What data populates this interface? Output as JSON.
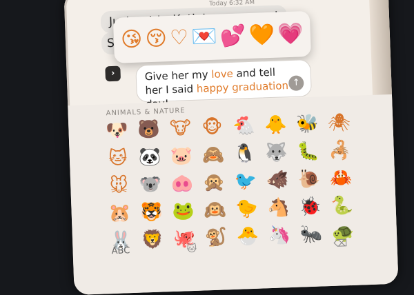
{
  "conversation": {
    "timestamp": "Today 6:32 AM",
    "messages": [
      "Just got to Katie's ceremony!",
      "S"
    ]
  },
  "compose": {
    "parts": [
      {
        "text": "Give her my ",
        "highlight": false
      },
      {
        "text": "love",
        "highlight": true
      },
      {
        "text": " and tell her I said ",
        "highlight": false
      },
      {
        "text": "happy graduation",
        "highlight": true
      },
      {
        "text": " day!",
        "highlight": false
      }
    ],
    "send_icon": "↑",
    "apps_icon": "›"
  },
  "emoji_suggestions": [
    "😘",
    "😚",
    "♡",
    "💌",
    "💕",
    "🧡",
    "💗"
  ],
  "keyboard": {
    "section": "ANIMALS & NATURE",
    "emojis": [
      "🐶",
      "🐻",
      "🐮",
      "🐵",
      "🐔",
      "🐥",
      "🐝",
      "🕷",
      "🐱",
      "🐼",
      "🐷",
      "🙈",
      "🐧",
      "🐺",
      "🐛",
      "🦂",
      "🐭",
      "🐨",
      "🐽",
      "🙊",
      "🐦",
      "🐗",
      "🐌",
      "🦀",
      "🐹",
      "🐯",
      "🐸",
      "🙉",
      "🐤",
      "🐴",
      "🐞",
      "🐍",
      "🐰",
      "🦁",
      "🐙",
      "🐒",
      "🐣",
      "🦄",
      "🐜",
      "🐢"
    ],
    "abc": "ABC",
    "face_icon": "🐱",
    "delete_icon": "⌫"
  },
  "colors": {
    "accent": "#e07b2a",
    "bubble": "#e6e3df"
  }
}
